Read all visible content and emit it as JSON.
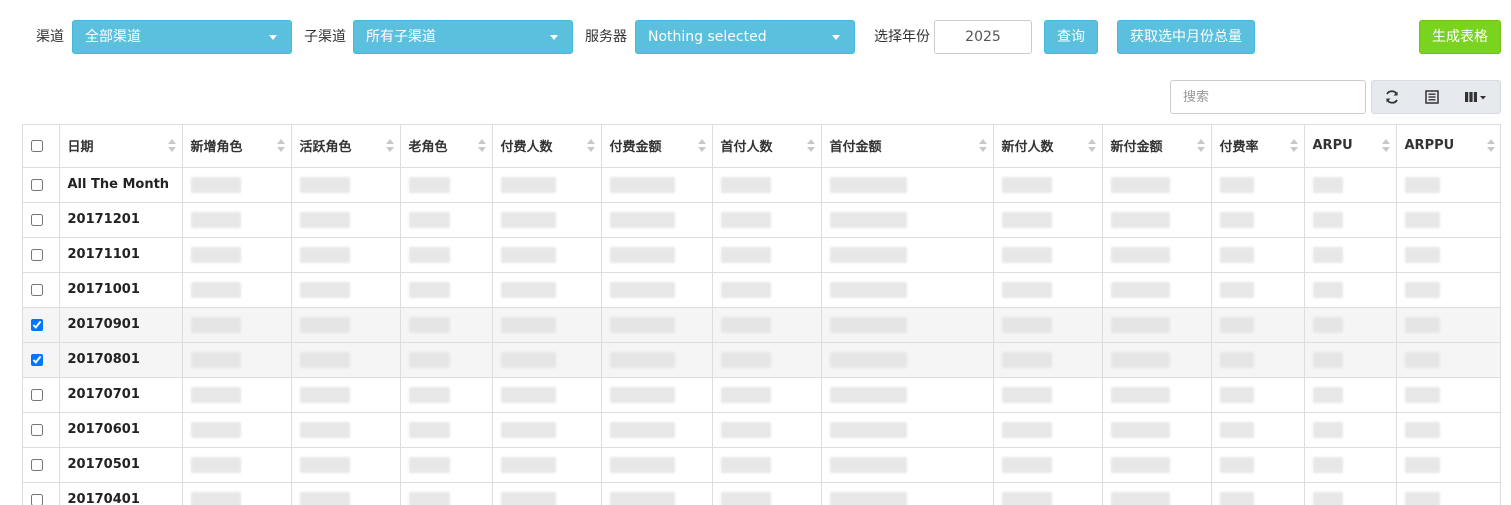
{
  "filters": {
    "channel_label": "渠道",
    "channel_value": "全部渠道",
    "subchannel_label": "子渠道",
    "subchannel_value": "所有子渠道",
    "server_label": "服务器",
    "server_value": "Nothing selected",
    "year_label": "选择年份",
    "year_value": "2025",
    "query_button": "查询",
    "monthly_total_button": "获取选中月份总量",
    "generate_table_button": "生成表格"
  },
  "toolbar": {
    "search_placeholder": "搜索",
    "icons": [
      "refresh-icon",
      "list-toggle-icon",
      "columns-icon"
    ]
  },
  "table": {
    "columns": [
      "日期",
      "新增角色",
      "活跃角色",
      "老角色",
      "付费人数",
      "付费金额",
      "首付人数",
      "首付金额",
      "新付人数",
      "新付金额",
      "付费率",
      "ARPU",
      "ARPPU"
    ],
    "rows": [
      {
        "date": "All The Month",
        "checked": false
      },
      {
        "date": "20171201",
        "checked": false
      },
      {
        "date": "20171101",
        "checked": false
      },
      {
        "date": "20171001",
        "checked": false
      },
      {
        "date": "20170901",
        "checked": true
      },
      {
        "date": "20170801",
        "checked": true
      },
      {
        "date": "20170701",
        "checked": false
      },
      {
        "date": "20170601",
        "checked": false
      },
      {
        "date": "20170501",
        "checked": false
      },
      {
        "date": "20170401",
        "checked": false
      }
    ]
  }
}
